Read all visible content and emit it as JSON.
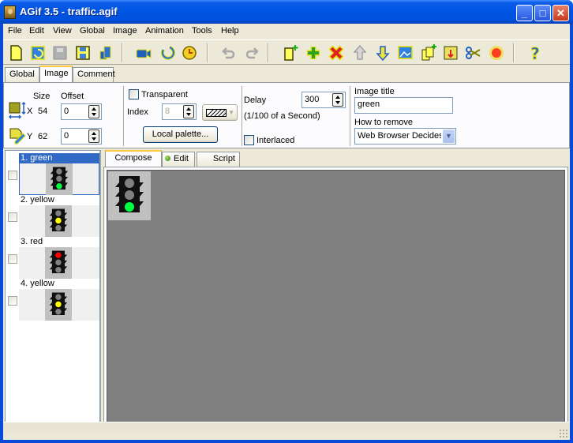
{
  "window": {
    "title": "AGif 3.5 - traffic.agif",
    "controls": [
      "minimize",
      "maximize",
      "close"
    ]
  },
  "menu": [
    "File",
    "Edit",
    "View",
    "Global",
    "Image",
    "Animation",
    "Tools",
    "Help"
  ],
  "toolbar": {
    "groups": [
      [
        "new-file-icon",
        "open-file-icon",
        "properties-icon-disabled",
        "save-icon",
        "save-as-icon"
      ],
      [
        "preview-camera-icon",
        "refresh-icon",
        "timer-icon"
      ],
      [
        "undo-icon-disabled",
        "redo-icon-disabled"
      ],
      [
        "add-image-icon",
        "insert-icon",
        "delete-icon",
        "move-up-icon-disabled",
        "move-down-icon",
        "import-image-icon",
        "duplicate-icon",
        "export-icon",
        "split-icon",
        "effect-icon"
      ],
      [
        "help-icon"
      ]
    ]
  },
  "top_tabs": [
    {
      "label": "Global",
      "active": false
    },
    {
      "label": "Image",
      "active": true
    },
    {
      "label": "Comment",
      "active": false
    }
  ],
  "image_props": {
    "size_label": "Size",
    "offset_label": "Offset",
    "x_label": "X",
    "x_size": "54",
    "x_offset": "0",
    "y_label": "Y",
    "y_size": "62",
    "y_offset": "0",
    "transparent_label": "Transparent",
    "transparent_checked": false,
    "index_label": "Index",
    "index_value": "8",
    "local_palette_label": "Local palette...",
    "delay_label": "Delay",
    "delay_value": "300",
    "delay_unit": "(1/100 of a Second)",
    "interlaced_label": "Interlaced",
    "interlaced_checked": false,
    "image_title_label": "Image title",
    "image_title_value": "green",
    "how_to_remove_label": "How to remove",
    "how_to_remove_value": "Web Browser Decides"
  },
  "frames": [
    {
      "name": "1. green",
      "active_light": "green",
      "selected": true
    },
    {
      "name": "2. yellow",
      "active_light": "yellow",
      "selected": false
    },
    {
      "name": "3. red",
      "active_light": "red",
      "selected": false
    },
    {
      "name": "4. yellow",
      "active_light": "yellow",
      "selected": false
    }
  ],
  "editor_tabs": [
    {
      "label": "Compose",
      "active": true
    },
    {
      "label": "Edit",
      "active": false
    },
    {
      "label": "Script",
      "active": false
    }
  ],
  "colors": {
    "light_green": "#00ff40",
    "light_yellow": "#ffff00",
    "light_red": "#ff0000",
    "light_off": "#808080",
    "selection": "#316ac5"
  }
}
